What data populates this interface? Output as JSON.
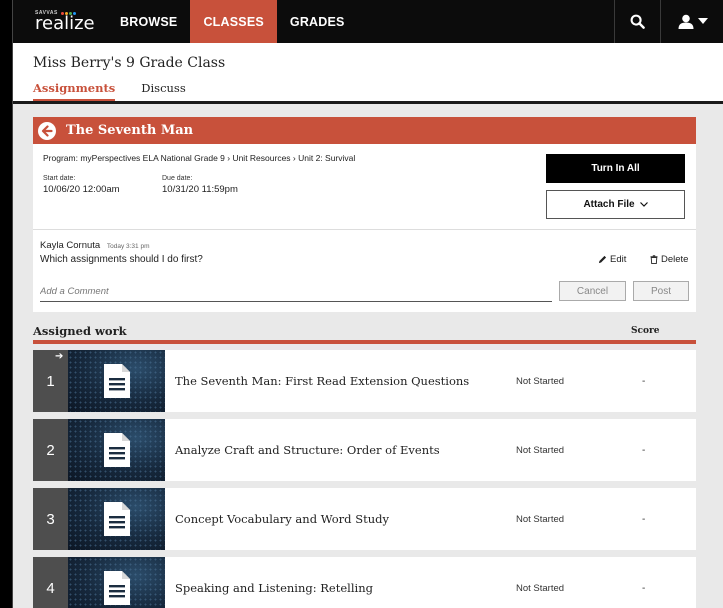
{
  "nav": {
    "logo_brand": "SAVVAS",
    "logo_word": "realize",
    "items": [
      "BROWSE",
      "CLASSES",
      "GRADES"
    ],
    "active_index": 1
  },
  "class": {
    "title": "Miss Berry's 9 Grade Class",
    "tabs": [
      "Assignments",
      "Discuss"
    ]
  },
  "assignment": {
    "title": "The Seventh Man",
    "program": "Program: myPerspectives ELA National Grade 9 › Unit Resources › Unit 2: Survival",
    "start_label": "Start date:",
    "start_value": "10/06/20 12:00am",
    "due_label": "Due date:",
    "due_value": "10/31/20 11:59pm",
    "turn_in_label": "Turn In All",
    "attach_label": "Attach File"
  },
  "comment": {
    "author": "Kayla Cornuta",
    "time": "Today 3:31 pm",
    "text": "Which assignments should I do first?",
    "edit_label": "Edit",
    "delete_label": "Delete",
    "add_placeholder": "Add a Comment",
    "cancel_label": "Cancel",
    "post_label": "Post"
  },
  "assigned": {
    "header": "Assigned work",
    "score_header": "Score",
    "rows": [
      {
        "num": "1",
        "title": "The Seventh Man: First Read Extension Questions",
        "status": "Not Started",
        "score": "-"
      },
      {
        "num": "2",
        "title": "Analyze Craft and Structure: Order of Events",
        "status": "Not Started",
        "score": "-"
      },
      {
        "num": "3",
        "title": "Concept Vocabulary and Word Study",
        "status": "Not Started",
        "score": "-"
      },
      {
        "num": "4",
        "title": "Speaking and Listening: Retelling",
        "status": "Not Started",
        "score": "-"
      }
    ]
  },
  "colors": {
    "accent": "#c8513b",
    "nav_bg": "#0c0c0c",
    "number_bg": "#4e4e4e"
  },
  "icons": [
    "search-icon",
    "user-icon",
    "back-arrow-icon",
    "pencil-icon",
    "trash-icon",
    "document-icon",
    "arrow-right-icon",
    "chevron-down-icon"
  ]
}
